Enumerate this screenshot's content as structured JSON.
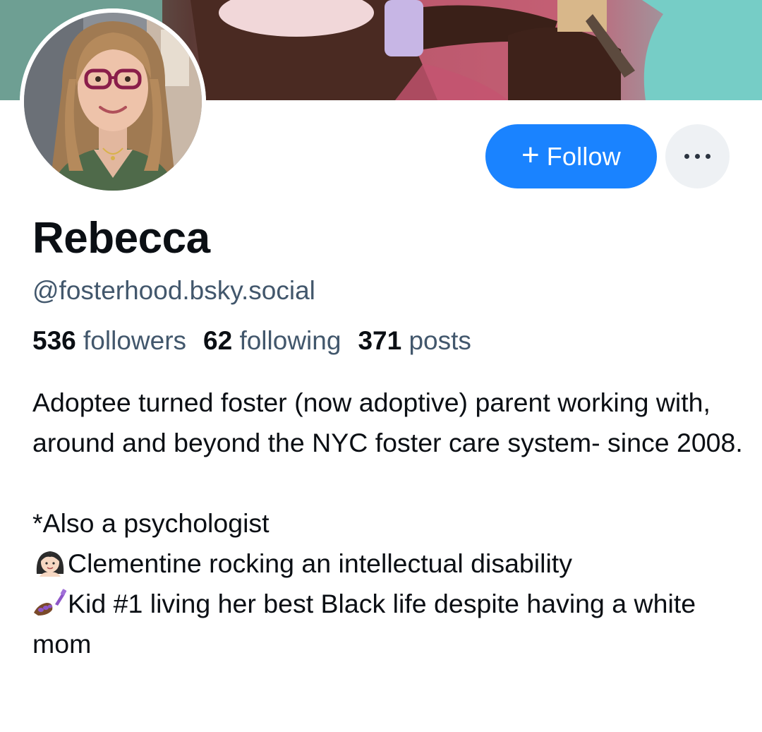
{
  "profile": {
    "display_name": "Rebecca",
    "handle": "@fosterhood.bsky.social",
    "stats": {
      "followers_count": "536",
      "followers_label": "followers",
      "following_count": "62",
      "following_label": "following",
      "posts_count": "371",
      "posts_label": "posts"
    },
    "bio": {
      "paragraph_1": "Adoptee turned foster (now adoptive) parent working with, around and beyond the NYC foster care system- since 2008.",
      "line_psychologist": "*Also a psychologist",
      "line_clementine": "Clementine rocking an intellectual disability",
      "line_kid1": "Kid #1 living her best Black life despite having a white mom",
      "emoji_clementine": "girl-emoji-icon",
      "emoji_kid1": "nail-polish-emoji-icon"
    }
  },
  "actions": {
    "follow_label": "Follow",
    "follow_icon": "plus-icon",
    "more_icon": "ellipsis-icon"
  },
  "colors": {
    "accent": "#1a83ff",
    "secondary_text": "#42576c",
    "primary_text": "#0b0f14",
    "more_button_bg": "#eef1f4"
  }
}
